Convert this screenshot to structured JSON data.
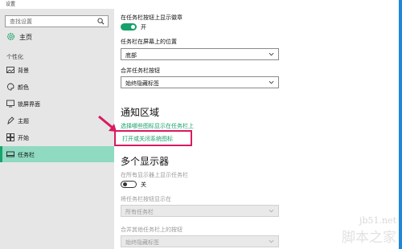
{
  "window": {
    "title": "设置"
  },
  "sidebar": {
    "search_placeholder": "查找设置",
    "home_label": "主页",
    "section_label": "个性化",
    "items": [
      {
        "label": "背景",
        "icon": "picture-icon"
      },
      {
        "label": "颜色",
        "icon": "palette-icon"
      },
      {
        "label": "锁屏界面",
        "icon": "lock-screen-icon"
      },
      {
        "label": "主题",
        "icon": "theme-icon"
      },
      {
        "label": "开始",
        "icon": "start-icon"
      },
      {
        "label": "任务栏",
        "icon": "taskbar-icon",
        "selected": true
      }
    ]
  },
  "content": {
    "badges_label": "在任务栏按钮上显示徽章",
    "badges_toggle_state": "开",
    "position_label": "任务栏在屏幕上的位置",
    "position_value": "底部",
    "combine_label": "合并任务栏按钮",
    "combine_value": "始终隐藏标签",
    "notification_heading": "通知区域",
    "notification_link1": "选择哪些图标显示在任务栏上",
    "notification_link2": "打开或关闭系统图标",
    "multi_display_heading": "多个显示器",
    "show_all_label": "在所有显示器上显示任务栏",
    "show_all_toggle_state": "关",
    "show_buttons_label": "将任务栏按钮显示在",
    "show_buttons_value": "所有任务栏",
    "combine_other_label": "合并其他任务栏上的按钮",
    "combine_other_value": "始终隐藏标签"
  },
  "watermark": {
    "url": "jb51.net",
    "name": "脚本之家"
  },
  "colors": {
    "accent": "#17a06a",
    "selected_bg": "#8fdac1",
    "highlight": "#d81b60"
  }
}
